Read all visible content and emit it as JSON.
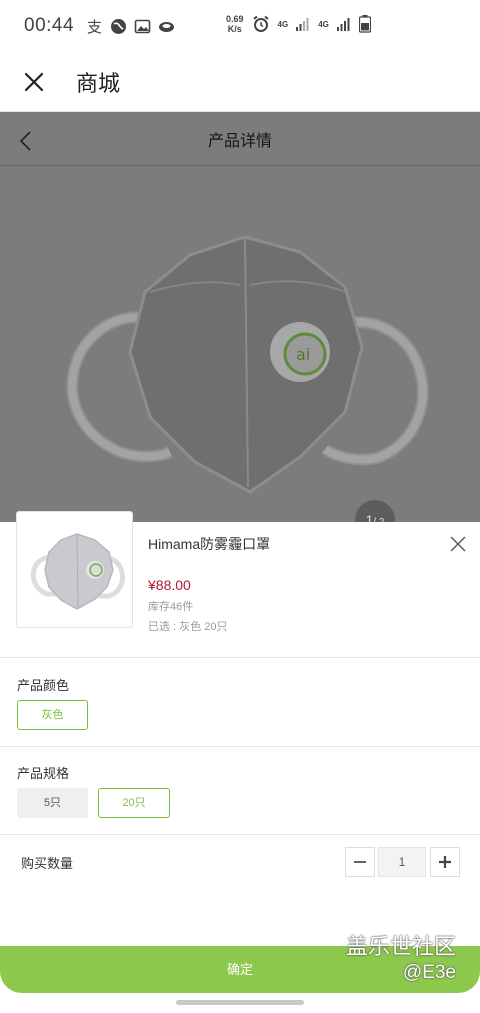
{
  "status_bar": {
    "time": "00:44",
    "speed_value": "0.69",
    "speed_unit": "K/s",
    "net1": "4G",
    "net2": "4G"
  },
  "app_bar": {
    "title": "商城"
  },
  "product_page": {
    "title": "产品详情",
    "image_index": "1",
    "image_total": "/ 2"
  },
  "sheet": {
    "product_name": "Himama防雾霾口罩",
    "price": "¥88.00",
    "stock": "库存46件",
    "selected": "已选 : 灰色 20只",
    "color_section": {
      "label": "产品颜色",
      "options": [
        {
          "label": "灰色",
          "selected": true
        }
      ]
    },
    "spec_section": {
      "label": "产品规格",
      "options": [
        {
          "label": "5只",
          "selected": false
        },
        {
          "label": "20只",
          "selected": true
        }
      ]
    },
    "quantity": {
      "label": "购买数量",
      "value": "1"
    },
    "confirm_label": "确定",
    "accent_color": "#8cc84b"
  },
  "watermark": {
    "line1": "盖乐世社区",
    "line2": "@E3e"
  }
}
